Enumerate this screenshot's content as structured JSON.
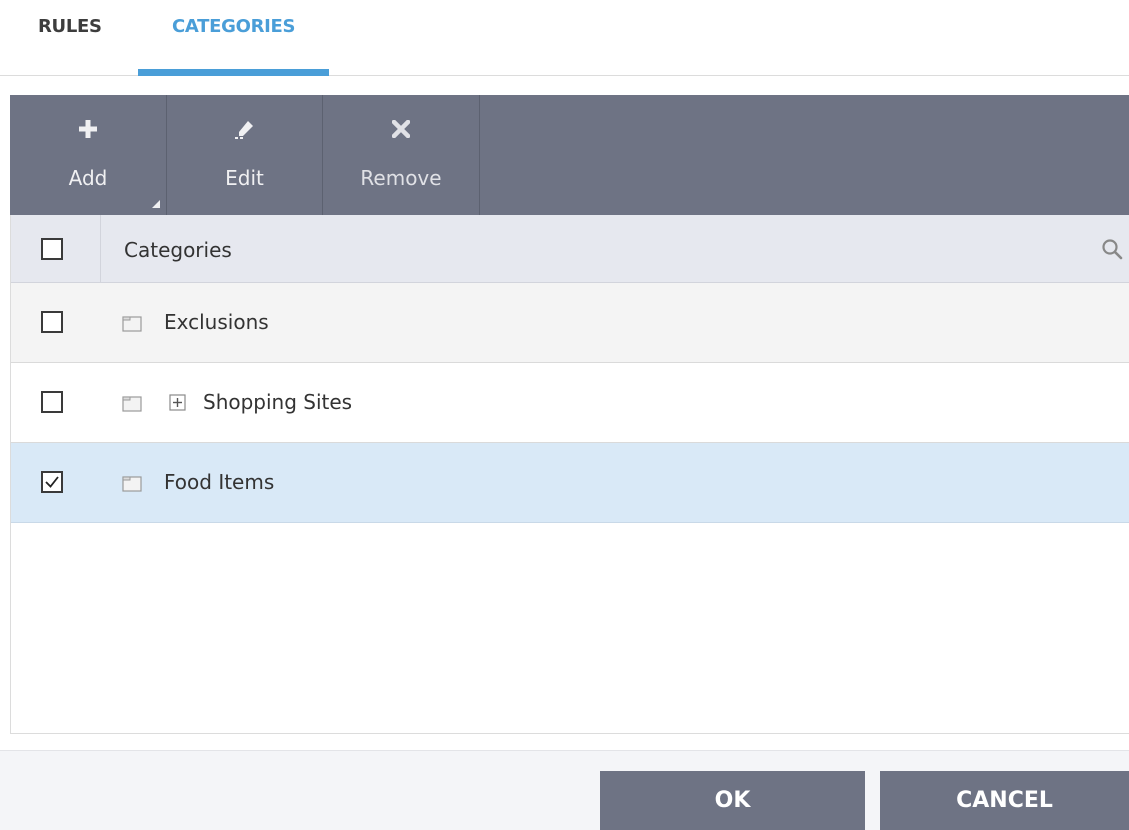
{
  "tabs": {
    "rules": "RULES",
    "categories": "CATEGORIES"
  },
  "toolbar": {
    "add": "Add",
    "edit": "Edit",
    "remove": "Remove"
  },
  "grid": {
    "header": "Categories",
    "rows": [
      {
        "label": "Exclusions",
        "checked": false,
        "expandable": false
      },
      {
        "label": "Shopping Sites",
        "checked": false,
        "expandable": true
      },
      {
        "label": "Food Items",
        "checked": true,
        "expandable": false
      }
    ]
  },
  "footer": {
    "ok": "OK",
    "cancel": "CANCEL"
  },
  "colors": {
    "accent": "#4a9ed8",
    "toolbar": "#6e7384",
    "selected_row": "#d9e9f7"
  }
}
